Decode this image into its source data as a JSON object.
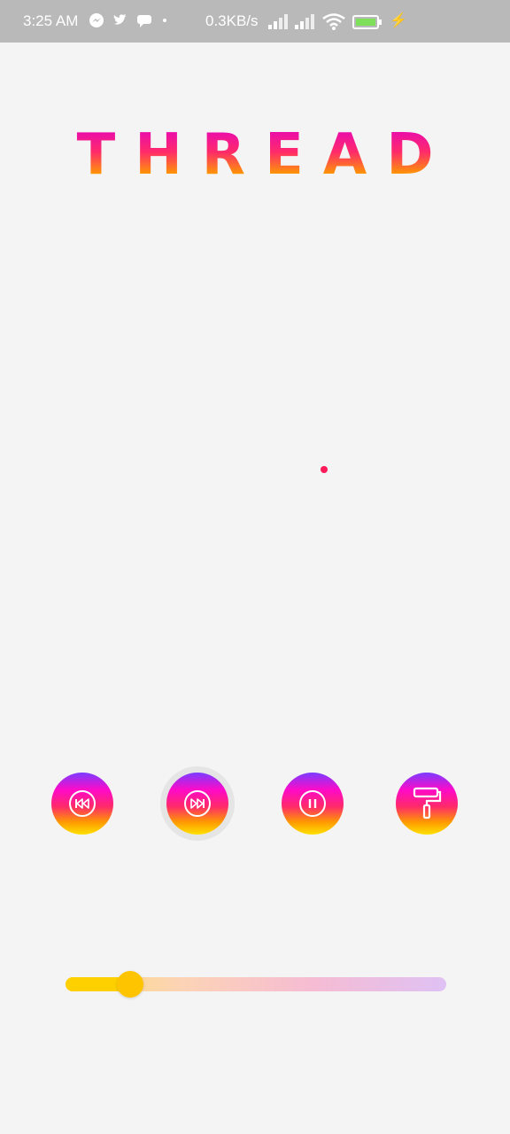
{
  "status_bar": {
    "time": "3:25 AM",
    "notification_icons": [
      "messenger-icon",
      "twitter-icon",
      "chat-icon"
    ],
    "net_speed": "0.3KB/s",
    "battery_icon": "battery-icon",
    "charging_icon": "charging-icon"
  },
  "app": {
    "title": "THREAD",
    "title_gradient": [
      "#e000c8",
      "#ff2a6a",
      "#ff9a00",
      "#ffd000"
    ]
  },
  "canvas": {
    "dot_color": "#ff1a5a"
  },
  "controls": [
    {
      "name": "rewind-button",
      "icon": "rewind-icon"
    },
    {
      "name": "fast-forward-button",
      "icon": "fast-forward-icon",
      "active": true
    },
    {
      "name": "pause-button",
      "icon": "pause-icon"
    },
    {
      "name": "paint-roller-button",
      "icon": "paint-roller-icon"
    }
  ],
  "slider": {
    "value": 0.17,
    "track_colors": [
      "#ffd54a",
      "#ffc9a0",
      "#f6a9c8",
      "#d8b0f4"
    ],
    "fill_color": "#ffd000"
  }
}
